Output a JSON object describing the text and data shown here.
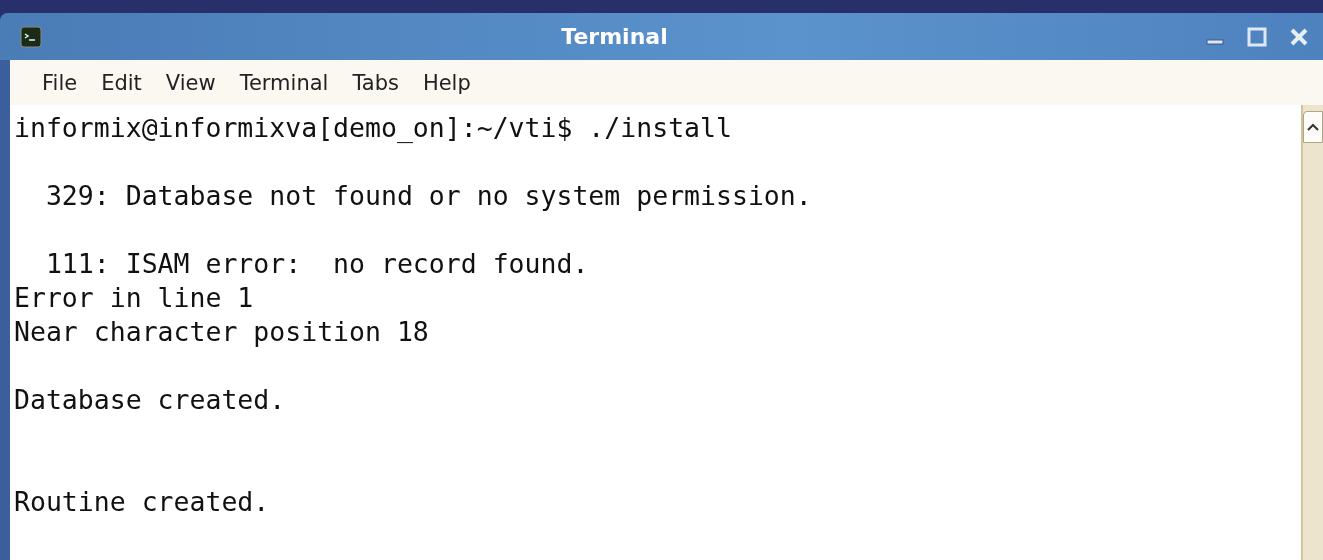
{
  "window": {
    "title": "Terminal"
  },
  "menu": [
    "File",
    "Edit",
    "View",
    "Terminal",
    "Tabs",
    "Help"
  ],
  "terminal": {
    "lines": [
      {
        "kind": "text",
        "text": "informix@informixva[demo_on]:~/vti$ ./install"
      },
      {
        "kind": "blank"
      },
      {
        "kind": "text",
        "text": "  329: Database not found or no system permission."
      },
      {
        "kind": "blank"
      },
      {
        "kind": "text",
        "text": "  111: ISAM error:  no record found."
      },
      {
        "kind": "text",
        "text": "Error in line 1"
      },
      {
        "kind": "text",
        "text": "Near character position 18"
      },
      {
        "kind": "blank"
      },
      {
        "kind": "text",
        "text": "Database created."
      },
      {
        "kind": "blank"
      },
      {
        "kind": "blank"
      },
      {
        "kind": "text",
        "text": "Routine created."
      },
      {
        "kind": "blank"
      }
    ]
  }
}
